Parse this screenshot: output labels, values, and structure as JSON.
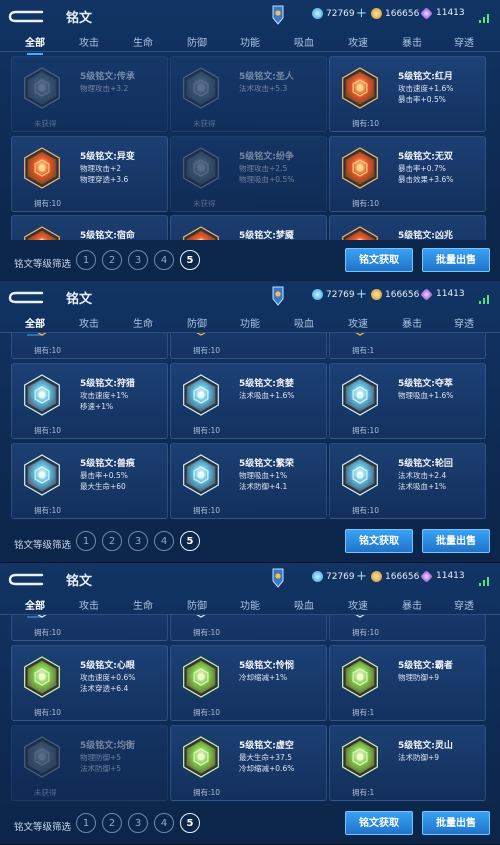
{
  "colors": {
    "accent": "#49a8ff",
    "button": "#2a8be0",
    "background": "#0f2d58"
  },
  "header": {
    "title": "铭文",
    "diamonds": "72769",
    "plus": "+",
    "coins": "166656",
    "gems": "11413"
  },
  "tabs": [
    "全部",
    "攻击",
    "生命",
    "防御",
    "功能",
    "吸血",
    "攻速",
    "暴击",
    "穿透"
  ],
  "bottom": {
    "filter_label": "铭文等级筛选",
    "levels": [
      "1",
      "2",
      "3",
      "4",
      "5"
    ],
    "get_button": "铭文获取",
    "sell_button": "批量出售"
  },
  "panels": [
    {
      "cards": [
        {
          "name": "5级铭文:传承",
          "stats": [
            "物理攻击+3.2"
          ],
          "owned": "未获得",
          "dim": true,
          "color": "gray"
        },
        {
          "name": "5级铭文:圣人",
          "stats": [
            "法术攻击+5.3"
          ],
          "owned": "未获得",
          "dim": true,
          "color": "gray"
        },
        {
          "name": "5级铭文:红月",
          "stats": [
            "攻击速度+1.6%",
            "暴击率+0.5%"
          ],
          "owned": "拥有:10",
          "dim": false,
          "color": "red"
        },
        {
          "name": "5级铭文:异变",
          "stats": [
            "物理攻击+2",
            "物理穿透+3.6"
          ],
          "owned": "拥有:10",
          "dim": false,
          "color": "red"
        },
        {
          "name": "5级铭文:纷争",
          "stats": [
            "物理攻击+2.5",
            "物理吸血+0.5%"
          ],
          "owned": "未获得",
          "dim": true,
          "color": "gray"
        },
        {
          "name": "5级铭文:无双",
          "stats": [
            "暴击率+0.7%",
            "暴击效果+3.6%"
          ],
          "owned": "拥有:10",
          "dim": false,
          "color": "red"
        },
        {
          "name": "5级铭文:宿命",
          "stats": [],
          "owned": "",
          "dim": false,
          "color": "red"
        },
        {
          "name": "5级铭文:梦魇",
          "stats": [],
          "owned": "",
          "dim": false,
          "color": "red"
        },
        {
          "name": "5级铭文:凶兆",
          "stats": [],
          "owned": "",
          "dim": false,
          "color": "red"
        }
      ]
    },
    {
      "cards": [
        {
          "name": "",
          "stats": [],
          "owned": "拥有:10",
          "dim": false,
          "color": "red"
        },
        {
          "name": "",
          "stats": [],
          "owned": "拥有:10",
          "dim": false,
          "color": "red"
        },
        {
          "name": "",
          "stats": [
            "每5秒回血+4.5"
          ],
          "owned": "拥有:1",
          "dim": false,
          "color": "red"
        },
        {
          "name": "5级铭文:狩猎",
          "stats": [
            "攻击速度+1%",
            "移速+1%"
          ],
          "owned": "拥有:10",
          "dim": false,
          "color": "blue"
        },
        {
          "name": "5级铭文:贪婪",
          "stats": [
            "法术吸血+1.6%"
          ],
          "owned": "拥有:10",
          "dim": false,
          "color": "blue"
        },
        {
          "name": "5级铭文:夺萃",
          "stats": [
            "物理吸血+1.6%"
          ],
          "owned": "拥有:10",
          "dim": false,
          "color": "blue"
        },
        {
          "name": "5级铭文:兽痕",
          "stats": [
            "暴击率+0.5%",
            "最大生命+60"
          ],
          "owned": "拥有:10",
          "dim": false,
          "color": "blue"
        },
        {
          "name": "5级铭文:繁荣",
          "stats": [
            "物理吸血+1%",
            "法术防御+4.1"
          ],
          "owned": "拥有:10",
          "dim": false,
          "color": "blue"
        },
        {
          "name": "5级铭文:轮回",
          "stats": [
            "法术攻击+2.4",
            "法术吸血+1%"
          ],
          "owned": "拥有:10",
          "dim": false,
          "color": "blue"
        }
      ]
    },
    {
      "cards": [
        {
          "name": "",
          "stats": [],
          "owned": "拥有:10",
          "dim": false,
          "color": "blue"
        },
        {
          "name": "",
          "stats": [],
          "owned": "拥有:10",
          "dim": false,
          "color": "blue"
        },
        {
          "name": "",
          "stats": [],
          "owned": "拥有:10",
          "dim": false,
          "color": "blue"
        },
        {
          "name": "5级铭文:心眼",
          "stats": [
            "攻击速度+0.6%",
            "法术穿透+6.4"
          ],
          "owned": "拥有:10",
          "dim": false,
          "color": "green"
        },
        {
          "name": "5级铭文:怜悯",
          "stats": [
            "冷却缩减+1%"
          ],
          "owned": "拥有:10",
          "dim": false,
          "color": "green"
        },
        {
          "name": "5级铭文:霸者",
          "stats": [
            "物理防御+9"
          ],
          "owned": "拥有:1",
          "dim": false,
          "color": "green"
        },
        {
          "name": "5级铭文:均衡",
          "stats": [
            "物理防御+5",
            "法术防御+5"
          ],
          "owned": "未获得",
          "dim": true,
          "color": "gray"
        },
        {
          "name": "5级铭文:虚空",
          "stats": [
            "最大生命+37.5",
            "冷却缩减+0.6%"
          ],
          "owned": "拥有:10",
          "dim": false,
          "color": "green"
        },
        {
          "name": "5级铭文:灵山",
          "stats": [
            "法术防御+9"
          ],
          "owned": "拥有:1",
          "dim": false,
          "color": "green"
        }
      ]
    }
  ]
}
